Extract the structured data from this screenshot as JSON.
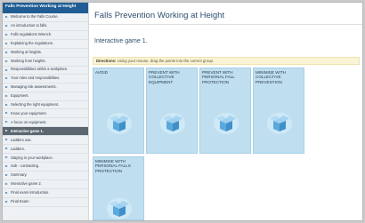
{
  "sidebar": {
    "title": "Falls Prevention Working at Height",
    "items": [
      {
        "label": "Welcome to the Falls Course."
      },
      {
        "label": "An introduction to falls."
      },
      {
        "label": "Falls regulations Wrench."
      },
      {
        "label": "Explaining the regulations."
      },
      {
        "label": "Working at heights."
      },
      {
        "label": "Working from heights."
      },
      {
        "label": "Responsibilities within a workplace."
      },
      {
        "label": "Your roles and responsibilities."
      },
      {
        "label": "Managing risk assessments."
      },
      {
        "label": "Equipment."
      },
      {
        "label": "Selecting the right equipment."
      },
      {
        "label": "Know your equipment."
      },
      {
        "label": "A focus on equipment."
      },
      {
        "label": "Interactive game 1."
      },
      {
        "label": "Ladders use."
      },
      {
        "label": "Ladders."
      },
      {
        "label": "Staying in your workplace."
      },
      {
        "label": "Sub - contracting."
      },
      {
        "label": "Summary."
      },
      {
        "label": "Interactive game 2."
      },
      {
        "label": "Final exam introduction."
      },
      {
        "label": "Final Exam"
      }
    ]
  },
  "main": {
    "page_title": "Falls Prevention Working at Height",
    "game_title": "Interactive game 1.",
    "directions_label": "Directions:",
    "directions_text": "Using your mouse, drag the points into the correct group.",
    "cards": [
      {
        "label": "AVOID",
        "icon": "drop-box-icon"
      },
      {
        "label": "PREVENT with collective equipment",
        "icon": "drop-box-icon"
      },
      {
        "label": "PREVENT with personal fall protection",
        "icon": "drop-box-icon"
      },
      {
        "label": "MINIMISE with collective prevention",
        "icon": "drop-box-icon"
      },
      {
        "label": "MINIMISE with personal falls protection",
        "icon": "drop-box-icon"
      }
    ]
  },
  "colors": {
    "sidebar_header": "#1f5d94",
    "active_item": "#5b6670",
    "card_fill": "#bfdff0",
    "directions_bg": "#fbf3d5",
    "title_text": "#2d4e6e"
  }
}
